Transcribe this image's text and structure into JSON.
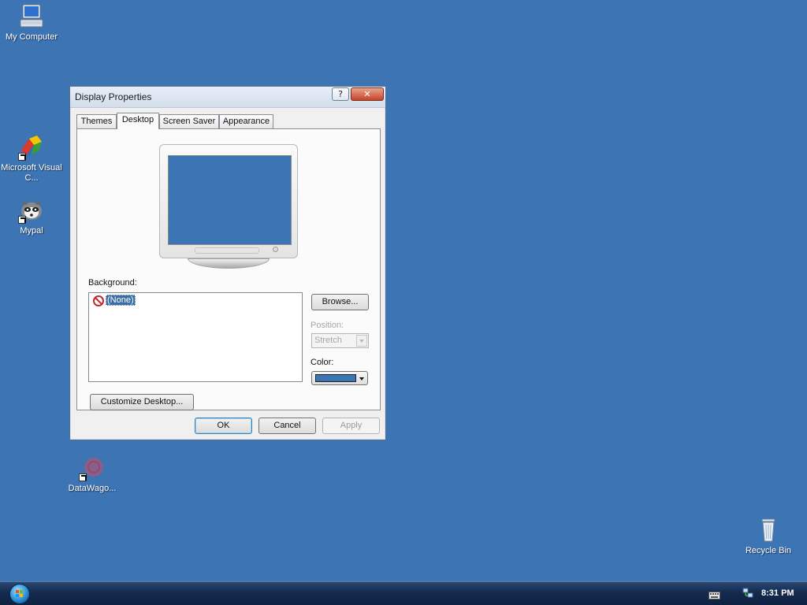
{
  "desktop": {
    "background_color": "#3c74b4",
    "icons": [
      {
        "name": "my-computer",
        "label": "My Computer",
        "icon": "computer-icon"
      },
      {
        "name": "microsoft-visual-c",
        "label": "Microsoft Visual C...",
        "icon": "visual-studio-icon"
      },
      {
        "name": "mypal",
        "label": "Mypal",
        "icon": "raccoon-icon"
      },
      {
        "name": "datawago",
        "label": "DataWago...",
        "icon": "datawagon-icon"
      },
      {
        "name": "recycle-bin",
        "label": "Recycle Bin",
        "icon": "recycle-bin-icon"
      }
    ]
  },
  "window": {
    "title": "Display Properties",
    "help_label": "?",
    "close_label": "✕",
    "tabs": [
      {
        "label": "Themes",
        "active": false
      },
      {
        "label": "Desktop",
        "active": true
      },
      {
        "label": "Screen Saver",
        "active": false
      },
      {
        "label": "Appearance",
        "active": false
      }
    ],
    "background_label": "Background:",
    "background_items": [
      {
        "label": "(None)",
        "selected": true,
        "icon": "none-icon"
      }
    ],
    "browse_label": "Browse...",
    "position_label": "Position:",
    "position_value": "Stretch",
    "color_label": "Color:",
    "color_value": "#3c74b4",
    "customize_label": "Customize Desktop...",
    "ok_label": "OK",
    "cancel_label": "Cancel",
    "apply_label": "Apply"
  },
  "taskbar": {
    "clock": "8:31 PM",
    "tray_icons": [
      "keyboard-icon",
      "network-icon"
    ]
  }
}
